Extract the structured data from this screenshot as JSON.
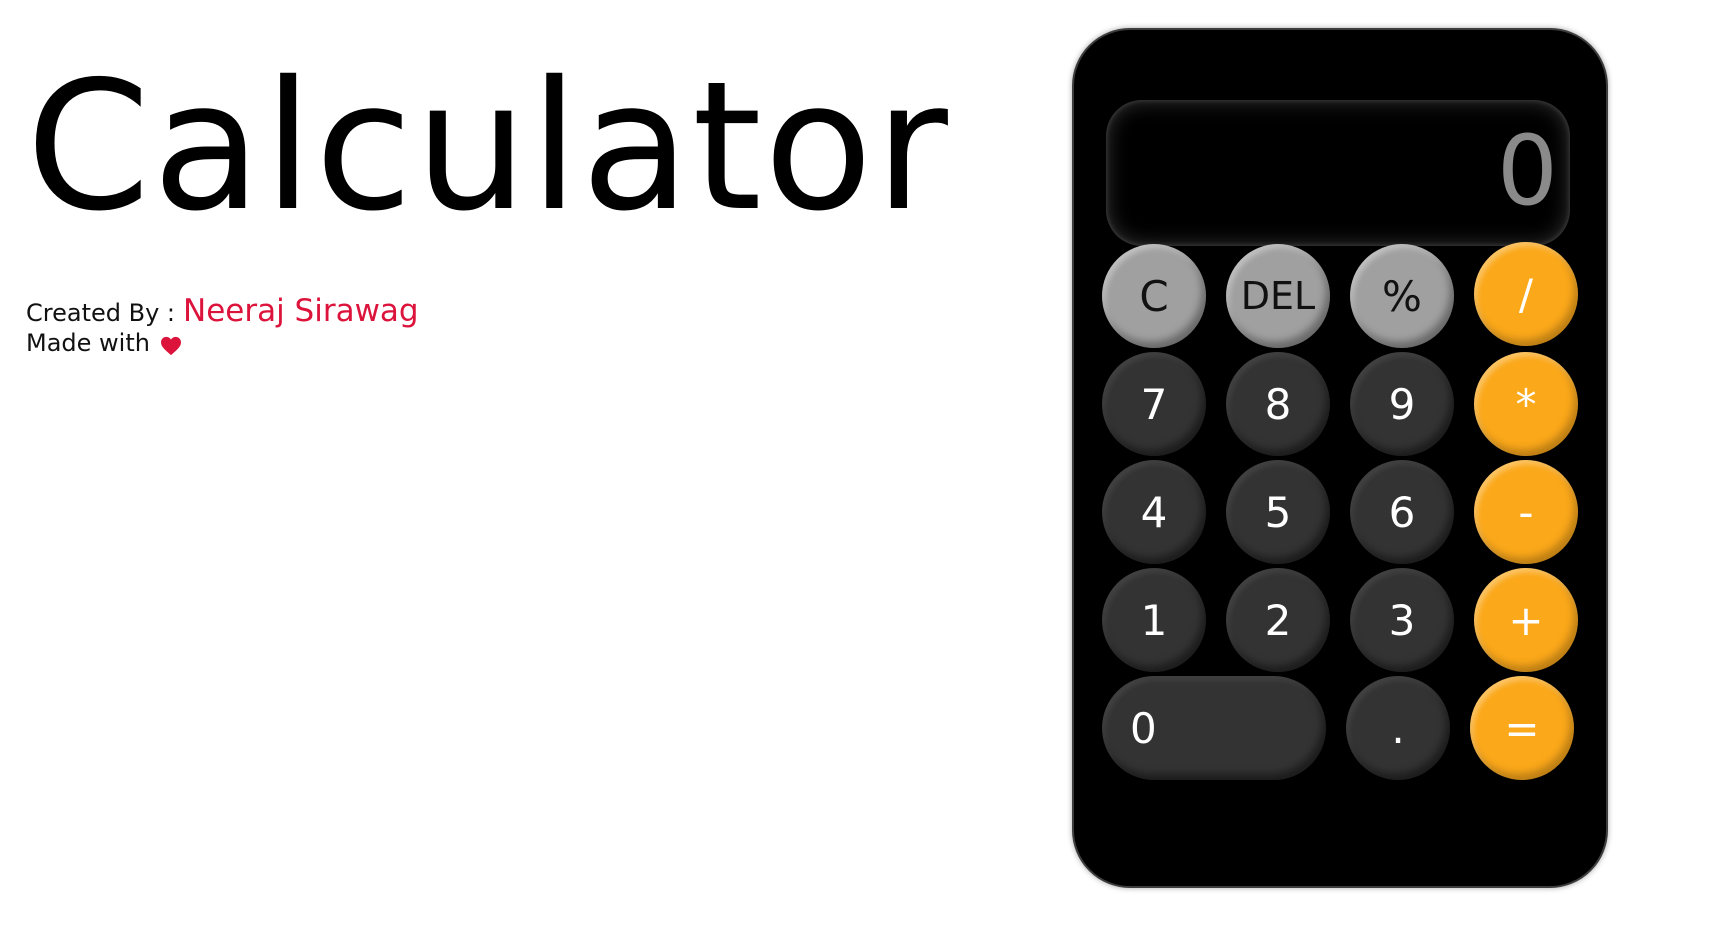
{
  "header": {
    "title": "Calculator"
  },
  "credits": {
    "created_by_label": "Created By :",
    "author_name": "Neeraj Sirawag",
    "made_with_label": "Made with",
    "heart_icon": "heart-icon"
  },
  "colors": {
    "accent_orange": "#fba81a",
    "function_gray": "#a0a0a0",
    "digit_dark": "#333333",
    "author_red": "#dc143c",
    "display_text": "#8a8a8a"
  },
  "calculator": {
    "display_value": "0",
    "keys": {
      "clear": "C",
      "delete": "DEL",
      "percent": "%",
      "divide": "/",
      "seven": "7",
      "eight": "8",
      "nine": "9",
      "multiply": "*",
      "four": "4",
      "five": "5",
      "six": "6",
      "subtract": "-",
      "one": "1",
      "two": "2",
      "three": "3",
      "add": "+",
      "zero": "0",
      "decimal": ".",
      "equals": "="
    }
  }
}
